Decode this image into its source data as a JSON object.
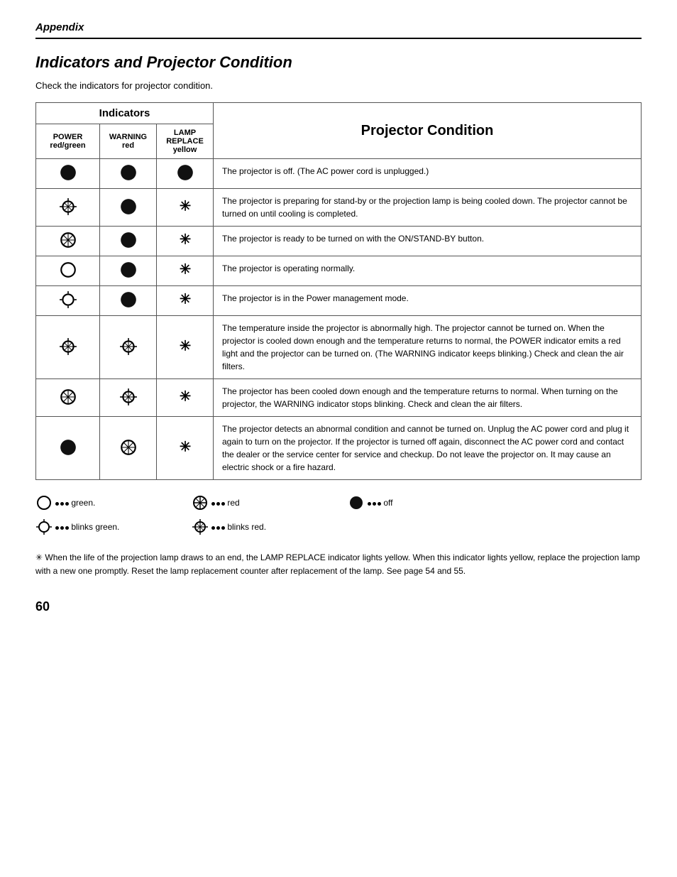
{
  "header": {
    "appendix_label": "Appendix"
  },
  "section": {
    "title": "Indicators and Projector Condition",
    "intro": "Check the indicators for projector condition."
  },
  "table": {
    "indicators_header": "Indicators",
    "projector_condition_header": "Projector Condition",
    "columns": {
      "power": "POWER",
      "power_sub": "red/green",
      "warning": "WARNING",
      "warning_sub": "red",
      "lamp": "LAMP REPLACE",
      "lamp_sub": "yellow"
    },
    "rows": [
      {
        "power_icon": "off",
        "warning_icon": "off",
        "lamp_icon": "off",
        "condition": "The projector is off.  (The AC power cord is unplugged.)"
      },
      {
        "power_icon": "blink-red",
        "warning_icon": "off",
        "lamp_icon": "asterisk",
        "condition": "The projector is preparing for stand-by or the projection lamp is being cooled down.  The projector cannot be turned on until cooling is completed."
      },
      {
        "power_icon": "red",
        "warning_icon": "off",
        "lamp_icon": "asterisk",
        "condition": "The projector is ready to be turned on with the ON/STAND-BY button."
      },
      {
        "power_icon": "green",
        "warning_icon": "off",
        "lamp_icon": "asterisk",
        "condition": "The projector is operating normally."
      },
      {
        "power_icon": "blink-green",
        "warning_icon": "off",
        "lamp_icon": "asterisk",
        "condition": "The projector is in the Power management mode."
      },
      {
        "power_icon": "blink-red",
        "warning_icon": "blink-red",
        "lamp_icon": "asterisk",
        "condition": "The temperature inside the projector is abnormally high.  The projector cannot be turned on.  When  the projector is cooled down enough and the temperature returns to normal, the POWER indicator emits a red light and the projector can be turned on.  (The WARNING indicator keeps blinking.)  Check and clean the air filters."
      },
      {
        "power_icon": "red",
        "warning_icon": "blink-red",
        "lamp_icon": "asterisk",
        "condition": "The projector has been cooled down enough and the temperature returns to normal.  When turning on the projector, the WARNING indicator stops blinking.  Check and clean the air filters."
      },
      {
        "power_icon": "off",
        "warning_icon": "red",
        "lamp_icon": "asterisk",
        "condition": "The projector detects an abnormal condition and cannot be turned on.  Unplug the AC power cord and plug it again to turn on the projector.  If the projector is turned off again, disconnect the AC power cord and contact the dealer or the service center for service and checkup.  Do not leave the projector on.  It may cause an electric shock or a fire hazard."
      }
    ]
  },
  "legend": {
    "green_label": "• • • green.",
    "red_label": "• • • red",
    "off_label": "• • • off",
    "blink_green_label": "• • • blinks green.",
    "blink_red_label": "• • • blinks red."
  },
  "footnote": {
    "symbol": "✳",
    "text": " When the life of the projection lamp draws to an end, the LAMP REPLACE indicator lights yellow. When this indicator lights yellow, replace the projection lamp with a new one promptly.  Reset the lamp replacement counter after replacement of the lamp.  See page 54 and 55."
  },
  "page_number": "60"
}
